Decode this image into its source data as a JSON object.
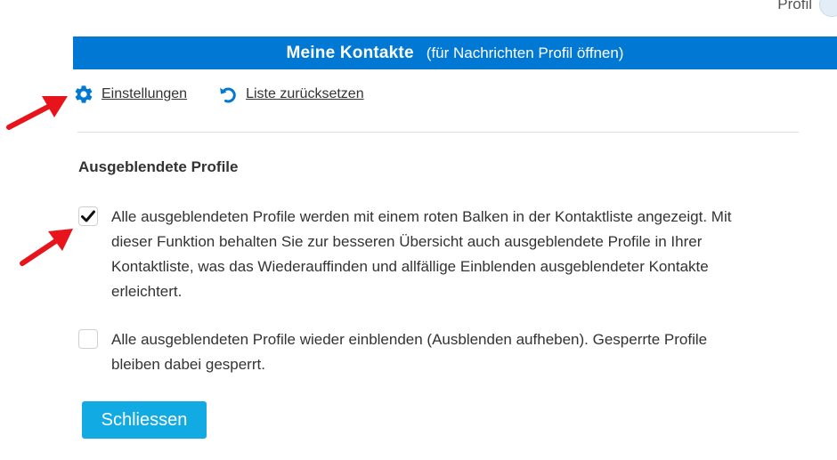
{
  "top_bar": {
    "user_label": "Profil"
  },
  "header": {
    "title": "Meine Kontakte",
    "subtitle": "(für Nachrichten Profil öffnen)"
  },
  "toolbar": {
    "settings_label": "Einstellungen",
    "reset_label": "Liste zurücksetzen",
    "settings_icon": "gear-icon",
    "reset_icon": "undo-icon"
  },
  "section": {
    "title": "Ausgeblendete Profile"
  },
  "options": [
    {
      "checked": true,
      "text": "Alle ausgeblendeten Profile werden mit einem roten Balken in der Kontaktliste angezeigt. Mit dieser Funktion behalten Sie zur besseren Übersicht auch ausgeblendete Profile in Ihrer Kontaktliste, was das Wiederauffinden und allfällige Einblenden ausgeblendeter Kontakte erleichtert."
    },
    {
      "checked": false,
      "text": "Alle ausgeblendeten Profile wieder einblenden (Ausblenden aufheben). Gesperrte Profile bleiben dabei gesperrt."
    }
  ],
  "close_button": {
    "label": "Schliessen"
  },
  "colors": {
    "header_bg": "#0078d4",
    "button_bg": "#12aae2",
    "icon_blue": "#0078d4",
    "annotation_arrow": "#e8141c"
  }
}
